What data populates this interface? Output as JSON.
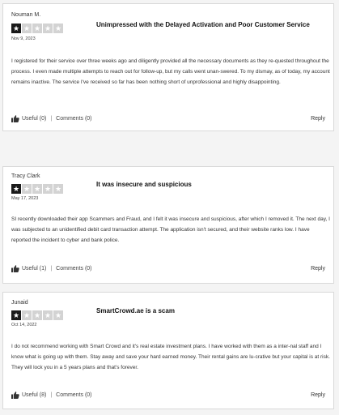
{
  "reviews": [
    {
      "author": "Nouman M.",
      "rating": 1,
      "max_rating": 5,
      "date": "Nov 9, 2023",
      "title": "Unimpressed with the Delayed Activation and Poor Customer Service",
      "body": "I registered for their service over three weeks ago and diligently provided all the necessary documents as they re-quested throughout the process. I even made multiple attempts to reach out for follow-up, but my calls went unan-swered. To my dismay, as of today, my account remains inactive. The service I've received so far has been nothing short of unprofessional and highly disappointing.",
      "useful_label": "Useful (0)",
      "comments_label": "Comments (0)",
      "reply_label": "Reply"
    },
    {
      "author": "Tracy Clark",
      "rating": 1,
      "max_rating": 5,
      "date": "May 17, 2023",
      "title": "It was insecure and suspicious",
      "body": "SI recently downloaded their app Scammers and Fraud, and I felt it was insecure and suspicious, after which I removed it. The next day, I was subjected to an unidentified debit card transaction attempt. The application isn't secured, and their website ranks low. I have reported the incident to cyber and bank police.",
      "useful_label": "Useful (1)",
      "comments_label": "Comments (0)",
      "reply_label": "Reply"
    },
    {
      "author": "Junaid",
      "rating": 1,
      "max_rating": 5,
      "date": "Oct 14, 2022",
      "title": "SmartCrowd.ae is a scam",
      "body": "I do not recommend working with Smart Crowd and it's real estate investment plans. I have worked with them as a inter-nal staff and I know what is going up with them. Stay away and save your hard earned money. Their rental gains are lu-crative but your capital is at risk. They will lock you in a 5 years plans and that's forever.",
      "useful_label": "Useful (8)",
      "comments_label": "Comments (0)",
      "reply_label": "Reply"
    }
  ],
  "colors": {
    "star_filled": "#1a1a1a",
    "star_empty": "#d3d3d3",
    "card_border": "#d9d9d9",
    "page_background": "#f4f4f4"
  },
  "icons": {
    "star": "star-icon",
    "useful": "thumbs-up-icon"
  }
}
